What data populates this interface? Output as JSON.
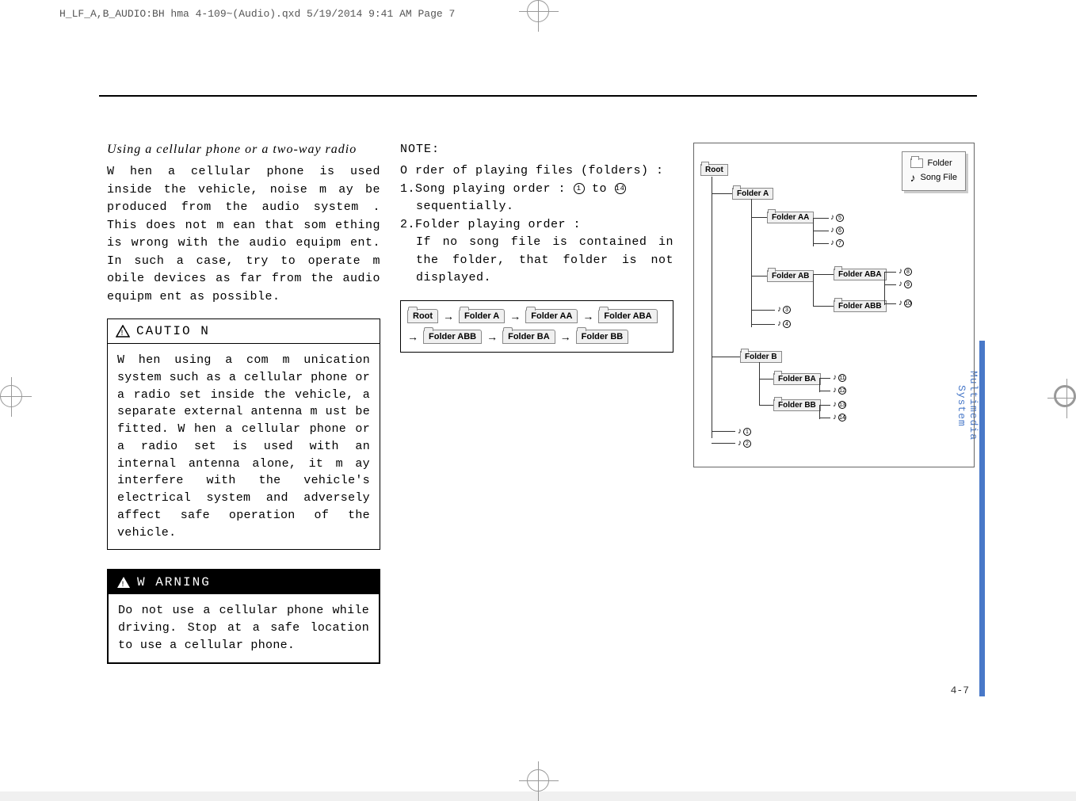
{
  "header_line": "H_LF_A,B_AUDIO:BH hma 4-109~(Audio).qxd  5/19/2014  9:41 AM  Page 7",
  "col1": {
    "heading": "Using a cellular phone or a two-way radio",
    "body": "W hen a cellular phone is used inside the vehicle, noise m ay be produced from  the audio system . This does not m ean that som ething is wrong with the audio equipm ent. In such a case, try to operate m obile devices as far from  the audio equipm ent as possible.",
    "caution_label": "CAUTIO N",
    "caution_body": "W hen using a com m unication system  such as a cellular phone or a radio set inside the vehicle, a separate external antenna m ust be fitted. W hen a cellular phone or a radio set is used with an internal antenna alone, it m ay interfere with the vehicle's electrical system  and adversely affect safe operation of the vehicle.",
    "warning_label": "W ARNING",
    "warning_body": "Do  not use a cellular phone while driving. Stop at a safe location to use a cellular phone."
  },
  "col2": {
    "note_label": "NOTE:",
    "order_line": "O rder of playing files (folders) :",
    "item1_pre": "1.Song playing order : ",
    "item1_from": "1",
    "item1_mid": " to ",
    "item1_to": "14",
    "item1_post": "sequentially.",
    "item2": "2.Folder playing order :",
    "item2_sub": "If no song file is contained in the folder, that folder is not displayed.",
    "flow": {
      "root": "Root",
      "a": "Folder A",
      "aa": "Folder AA",
      "aba": "Folder ABA",
      "abb": "Folder ABB",
      "ba": "Folder BA",
      "bb": "Folder BB"
    }
  },
  "col3": {
    "legend_folder": "Folder",
    "legend_song": "Song File",
    "tree": {
      "root": "Root",
      "a": "Folder A",
      "aa": "Folder AA",
      "ab": "Folder AB",
      "aba": "Folder ABA",
      "abb": "Folder ABB",
      "b": "Folder B",
      "ba": "Folder BA",
      "bb": "Folder BB"
    },
    "songs": {
      "s1": "1",
      "s2": "2",
      "s3": "3",
      "s4": "4",
      "s5": "5",
      "s6": "6",
      "s7": "7",
      "s8": "8",
      "s9": "9",
      "s10": "10",
      "s11": "11",
      "s12": "12",
      "s13": "13",
      "s14": "14"
    }
  },
  "side_tab": "Multimedia System",
  "page_num": "4-7"
}
